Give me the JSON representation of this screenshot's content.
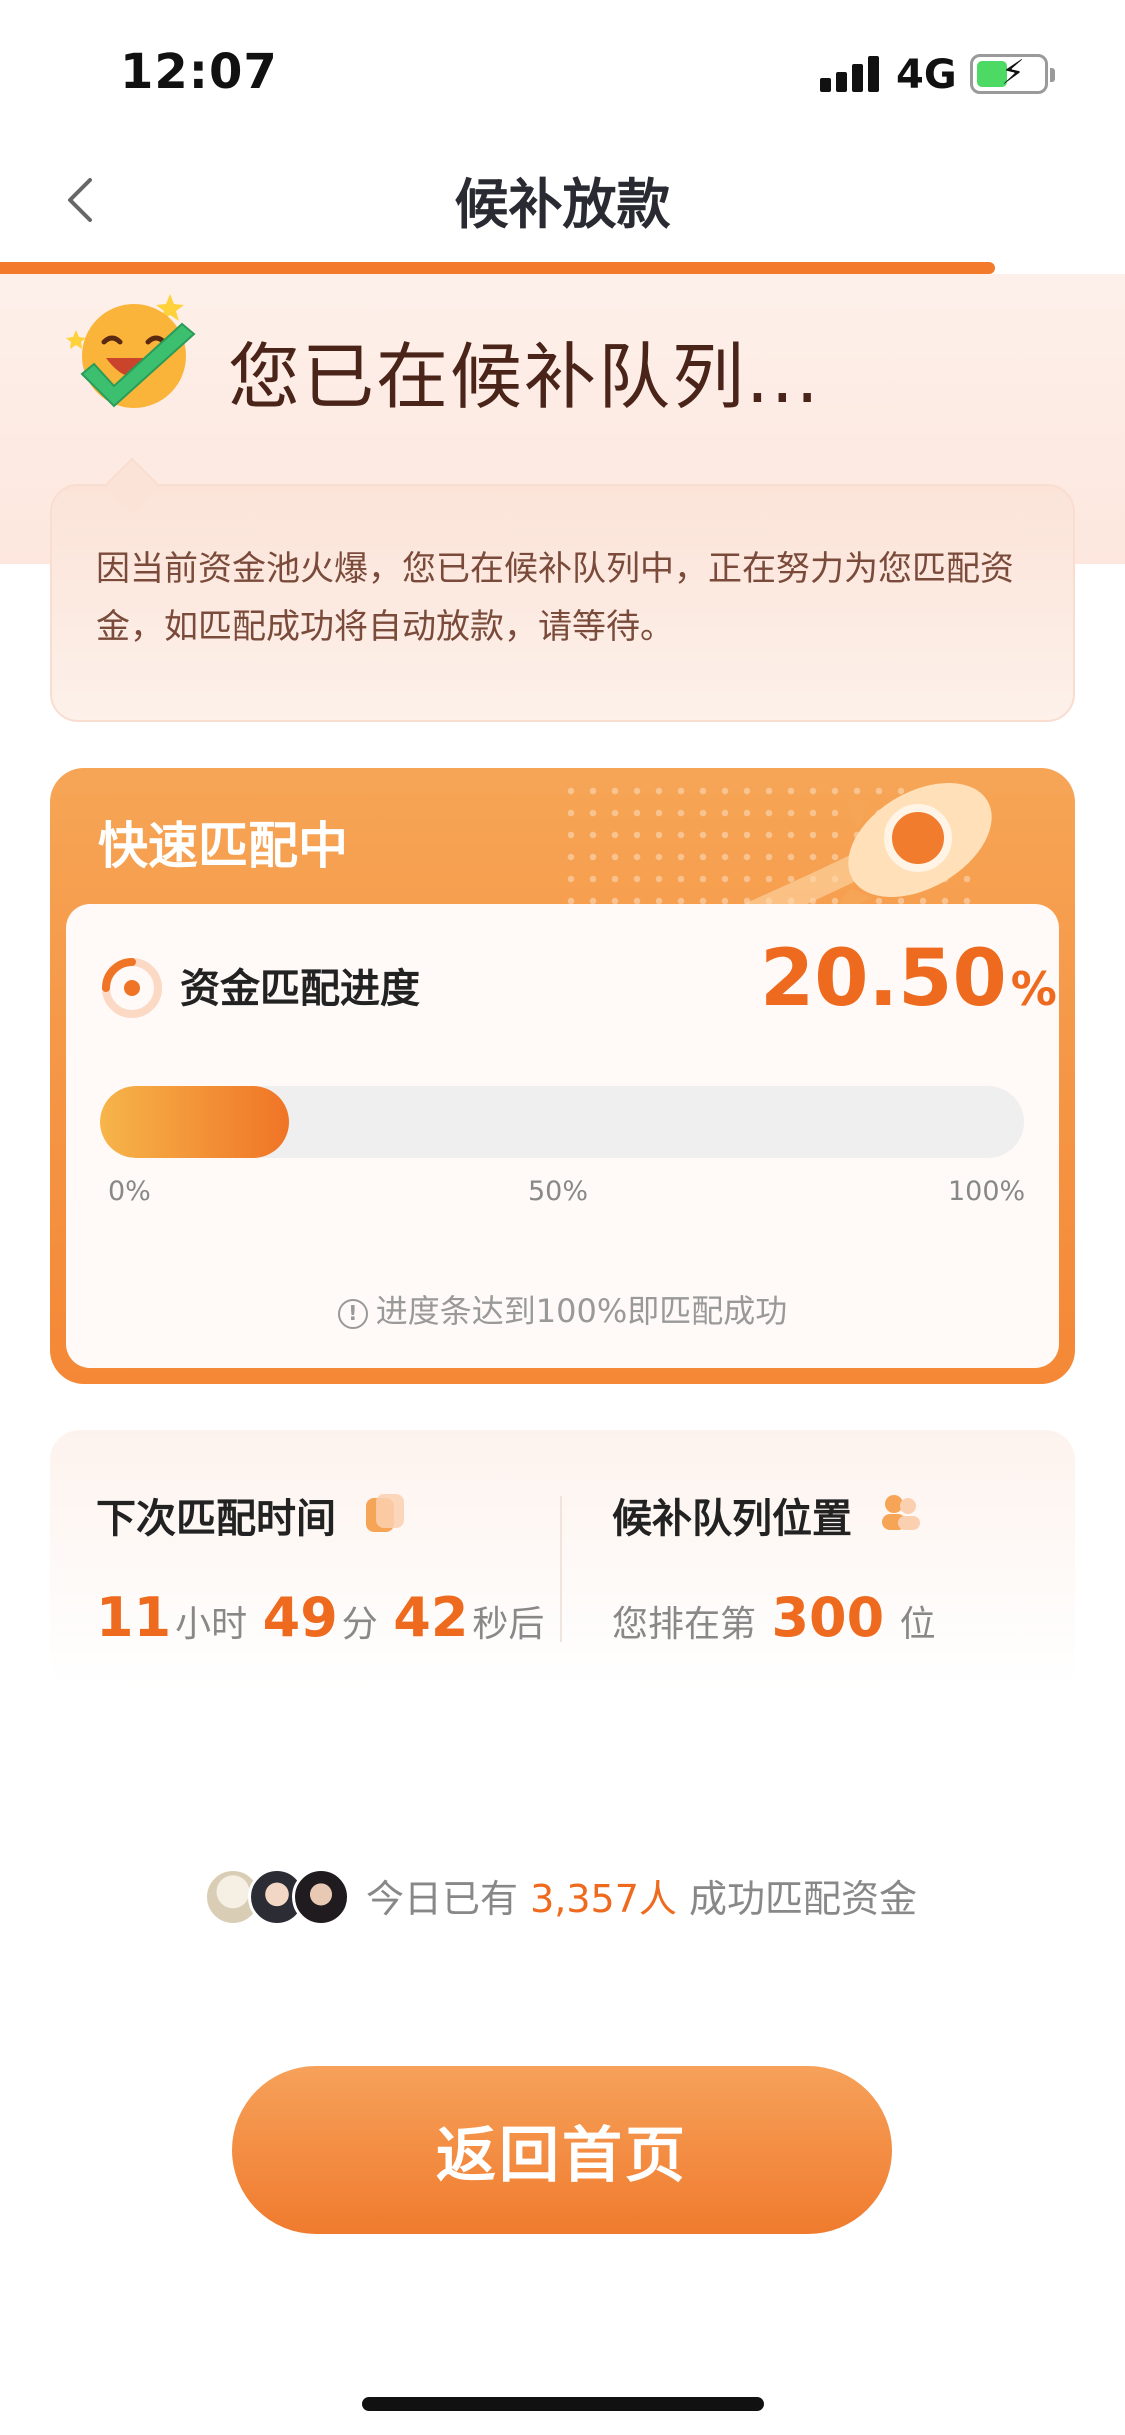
{
  "status_bar": {
    "time": "12:07",
    "network": "4G",
    "battery_charging": true
  },
  "nav": {
    "title": "候补放款",
    "back_icon": "chevron-left-icon"
  },
  "header": {
    "headline": "您已在候补队列..."
  },
  "notice": {
    "text": "因当前资金池火爆，您已在候补队列中，正在努力为您匹配资金，如匹配成功将自动放款，请等待。"
  },
  "match_card": {
    "title": "快速匹配中",
    "progress_label": "资金匹配进度",
    "progress_value": "20.50",
    "progress_unit": "%",
    "progress_fraction": 0.205,
    "ticks": [
      "0%",
      "50%",
      "100%"
    ],
    "hint": "进度条达到100%即匹配成功"
  },
  "info": {
    "next_match": {
      "title": "下次匹配时间",
      "hours": "11",
      "hours_unit": "小时",
      "minutes": "49",
      "minutes_unit": "分",
      "seconds": "42",
      "seconds_unit": "秒后"
    },
    "queue": {
      "title": "候补队列位置",
      "prefix": "您排在第",
      "position": "300",
      "suffix": "位"
    }
  },
  "social": {
    "prefix": "今日已有",
    "count": "3,357人",
    "suffix": "成功匹配资金"
  },
  "button": {
    "label": "返回首页"
  },
  "colors": {
    "accent": "#ee6a1e",
    "card_orange": "#f48836"
  }
}
